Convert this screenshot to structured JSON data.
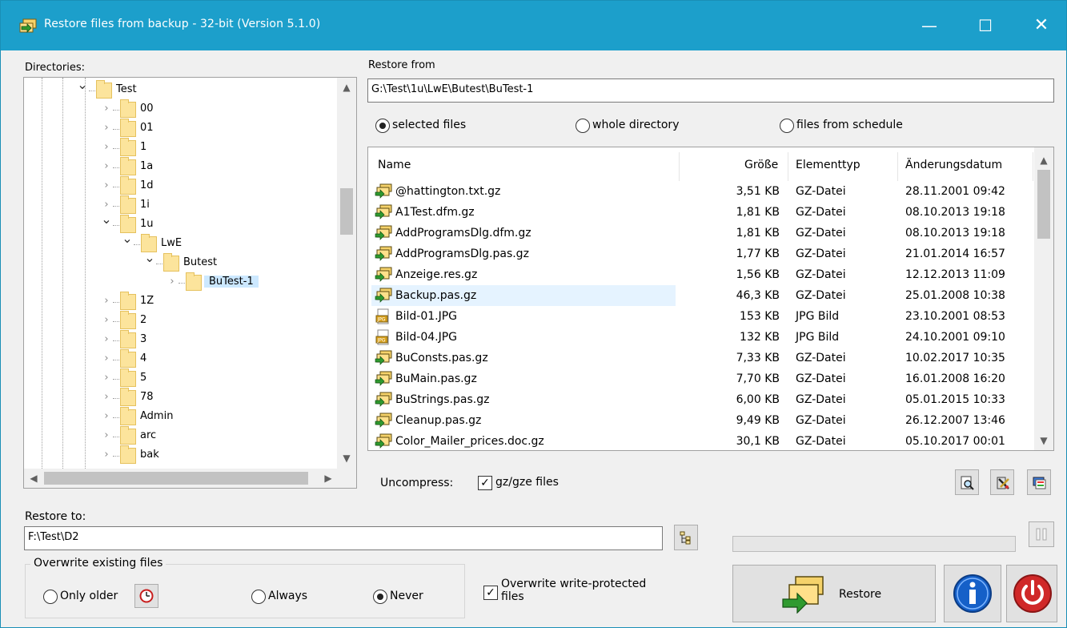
{
  "window": {
    "title": "Restore files from backup - 32-bit (Version 5.1.0)",
    "minimize_glyph": "—",
    "maximize_glyph": "☐",
    "close_glyph": "✕"
  },
  "directories": {
    "label": "Directories:",
    "nodes": [
      {
        "label": "Test",
        "level": 0,
        "expanded": true
      },
      {
        "label": "00",
        "level": 1,
        "expanded": false
      },
      {
        "label": "01",
        "level": 1,
        "expanded": false
      },
      {
        "label": "1",
        "level": 1,
        "expanded": false
      },
      {
        "label": "1a",
        "level": 1,
        "expanded": false
      },
      {
        "label": "1d",
        "level": 1,
        "expanded": false
      },
      {
        "label": "1i",
        "level": 1,
        "expanded": false
      },
      {
        "label": "1u",
        "level": 1,
        "expanded": true
      },
      {
        "label": "LwE",
        "level": 2,
        "expanded": true
      },
      {
        "label": "Butest",
        "level": 3,
        "expanded": true
      },
      {
        "label": "BuTest-1",
        "level": 4,
        "expanded": false,
        "selected": true
      },
      {
        "label": "1Z",
        "level": 1,
        "expanded": false
      },
      {
        "label": "2",
        "level": 1,
        "expanded": false
      },
      {
        "label": "3",
        "level": 1,
        "expanded": false
      },
      {
        "label": "4",
        "level": 1,
        "expanded": false
      },
      {
        "label": "5",
        "level": 1,
        "expanded": false
      },
      {
        "label": "78",
        "level": 1,
        "expanded": false
      },
      {
        "label": "Admin",
        "level": 1,
        "expanded": false
      },
      {
        "label": "arc",
        "level": 1,
        "expanded": false
      },
      {
        "label": "bak",
        "level": 1,
        "expanded": false
      }
    ]
  },
  "restore_from": {
    "label": "Restore from",
    "path": "G:\\Test\\1u\\LwE\\Butest\\BuTest-1",
    "options": [
      {
        "label": "selected files",
        "checked": true
      },
      {
        "label": "whole directory",
        "checked": false
      },
      {
        "label": "files from schedule",
        "checked": false
      }
    ]
  },
  "file_list": {
    "columns": [
      "Name",
      "Größe",
      "Elementtyp",
      "Änderungsdatum"
    ],
    "rows": [
      {
        "name": "@hattington.txt.gz",
        "size": "3,51 KB",
        "type": "GZ-Datei",
        "date": "28.11.2001 09:42",
        "icon": "gz-archive-icon"
      },
      {
        "name": "A1Test.dfm.gz",
        "size": "1,81 KB",
        "type": "GZ-Datei",
        "date": "08.10.2013 19:18",
        "icon": "gz-archive-icon"
      },
      {
        "name": "AddProgramsDlg.dfm.gz",
        "size": "1,81 KB",
        "type": "GZ-Datei",
        "date": "08.10.2013 19:18",
        "icon": "gz-archive-icon"
      },
      {
        "name": "AddProgramsDlg.pas.gz",
        "size": "1,77 KB",
        "type": "GZ-Datei",
        "date": "21.01.2014 16:57",
        "icon": "gz-archive-icon"
      },
      {
        "name": "Anzeige.res.gz",
        "size": "1,56 KB",
        "type": "GZ-Datei",
        "date": "12.12.2013 11:09",
        "icon": "gz-archive-icon"
      },
      {
        "name": "Backup.pas.gz",
        "size": "46,3 KB",
        "type": "GZ-Datei",
        "date": "25.01.2008 10:38",
        "icon": "gz-archive-icon",
        "selected": true
      },
      {
        "name": "Bild-01.JPG",
        "size": "153 KB",
        "type": "JPG Bild",
        "date": "23.10.2001 08:53",
        "icon": "jpg-image-icon"
      },
      {
        "name": "Bild-04.JPG",
        "size": "132 KB",
        "type": "JPG Bild",
        "date": "24.10.2001 09:10",
        "icon": "jpg-image-icon"
      },
      {
        "name": "BuConsts.pas.gz",
        "size": "7,33 KB",
        "type": "GZ-Datei",
        "date": "10.02.2017 10:35",
        "icon": "gz-archive-icon"
      },
      {
        "name": "BuMain.pas.gz",
        "size": "7,70 KB",
        "type": "GZ-Datei",
        "date": "16.01.2008 16:20",
        "icon": "gz-archive-icon"
      },
      {
        "name": "BuStrings.pas.gz",
        "size": "6,00 KB",
        "type": "GZ-Datei",
        "date": "05.01.2015 10:33",
        "icon": "gz-archive-icon"
      },
      {
        "name": "Cleanup.pas.gz",
        "size": "9,49 KB",
        "type": "GZ-Datei",
        "date": "26.12.2007 13:46",
        "icon": "gz-archive-icon"
      },
      {
        "name": "Color_Mailer_prices.doc.gz",
        "size": "30,1 KB",
        "type": "GZ-Datei",
        "date": "05.10.2017 00:01",
        "icon": "gz-archive-icon"
      }
    ]
  },
  "uncompress": {
    "label": "Uncompress:",
    "checkbox_label": "gz/gze files",
    "checked": true
  },
  "restore_to": {
    "label": "Restore to:",
    "path": "F:\\Test\\D2"
  },
  "overwrite": {
    "group_label": "Overwrite existing files",
    "options": [
      {
        "label": "Only older",
        "checked": false
      },
      {
        "label": "Always",
        "checked": false
      },
      {
        "label": "Never",
        "checked": true
      }
    ],
    "write_protected_label_line1": "Overwrite write-protected",
    "write_protected_label_line2": "files",
    "write_protected_checked": true
  },
  "buttons": {
    "restore_label": "Restore"
  },
  "progress": {
    "value": 0
  },
  "colors": {
    "titlebar": "#1c9fcb",
    "selection": "#cce8ff",
    "folder": "#fce49c",
    "info_button": "#1560c8",
    "power_button": "#d02828"
  }
}
